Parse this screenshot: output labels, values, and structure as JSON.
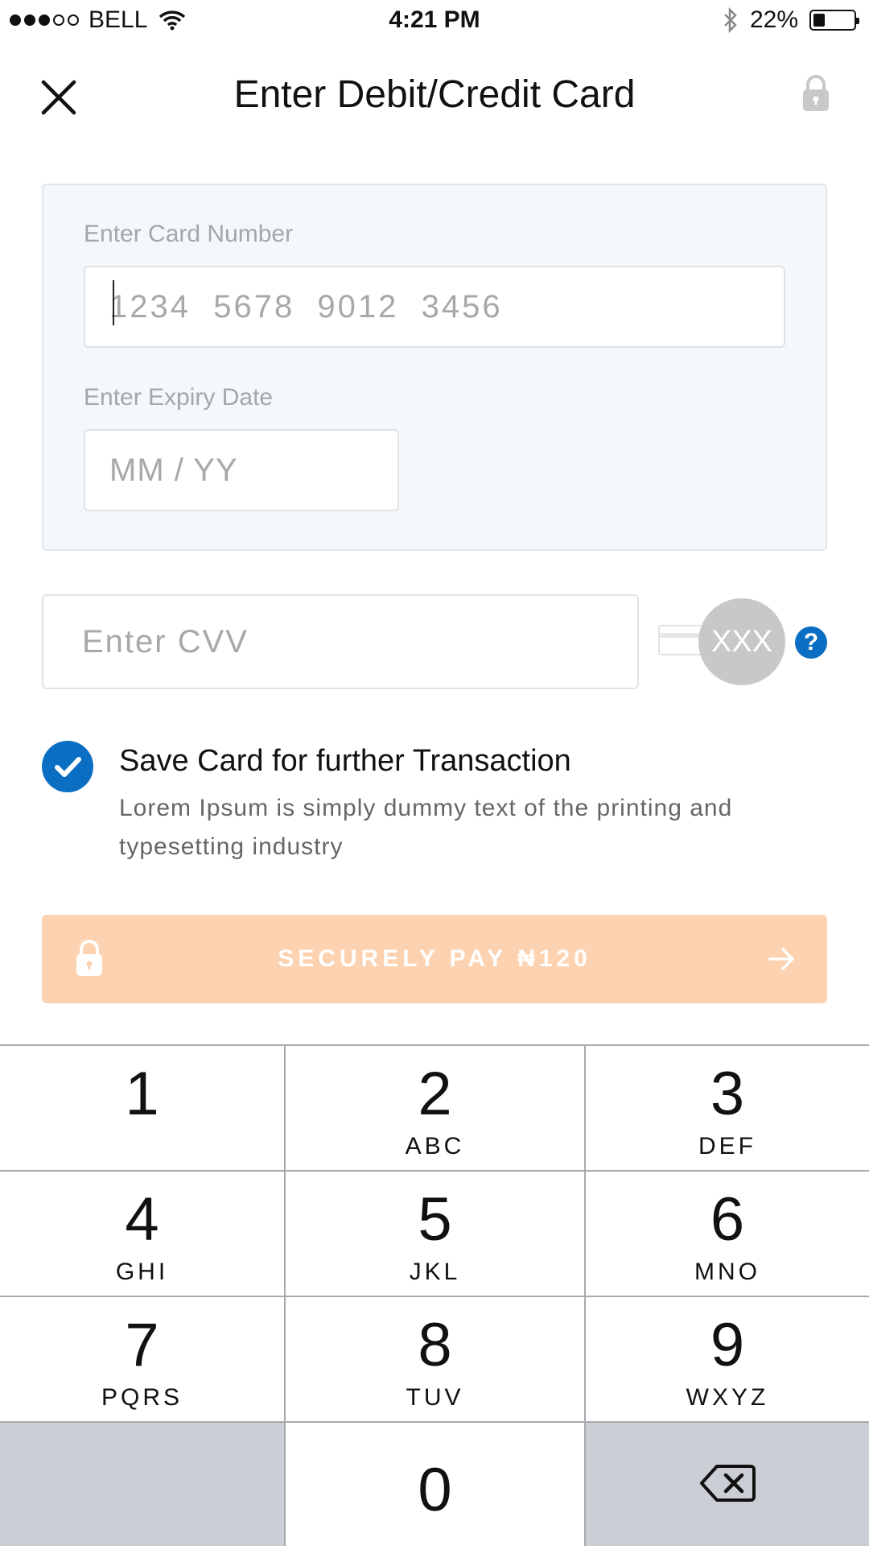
{
  "status_bar": {
    "carrier": "BELL",
    "time": "4:21 PM",
    "battery_percent": "22%",
    "battery_level": 0.22,
    "signal_bars_filled": 3,
    "signal_bars_total": 5,
    "icons": [
      "wifi-icon",
      "bluetooth-icon",
      "battery-icon"
    ]
  },
  "header": {
    "title": "Enter Debit/Credit Card",
    "close_icon": "close-icon",
    "lock_icon": "lock-icon"
  },
  "card_form": {
    "card_number_label": "Enter Card Number",
    "card_number_placeholder": "1234  5678  9012  3456",
    "expiry_label": "Enter Expiry Date",
    "expiry_placeholder": "MM / YY",
    "cvv_placeholder": "Enter CVV",
    "cvv_hint": "XXX"
  },
  "save_card": {
    "checked": true,
    "title": "Save Card for further Transaction",
    "description": "Lorem Ipsum is simply dummy text of the printing and typesetting industry"
  },
  "pay_button": {
    "label": "SECURELY PAY ₦120",
    "color": "#fcd2b0"
  },
  "keypad": {
    "keys": [
      {
        "num": "1",
        "letters": ""
      },
      {
        "num": "2",
        "letters": "ABC"
      },
      {
        "num": "3",
        "letters": "DEF"
      },
      {
        "num": "4",
        "letters": "GHI"
      },
      {
        "num": "5",
        "letters": "JKL"
      },
      {
        "num": "6",
        "letters": "MNO"
      },
      {
        "num": "7",
        "letters": "PQRS"
      },
      {
        "num": "8",
        "letters": "TUV"
      },
      {
        "num": "9",
        "letters": "WXYZ"
      },
      {
        "num": "0",
        "letters": ""
      }
    ],
    "delete_icon": "backspace-icon"
  },
  "colors": {
    "accent": "#0a6fc2",
    "panel_bg": "#f4f8fb",
    "keypad_gray": "#cbced4"
  }
}
